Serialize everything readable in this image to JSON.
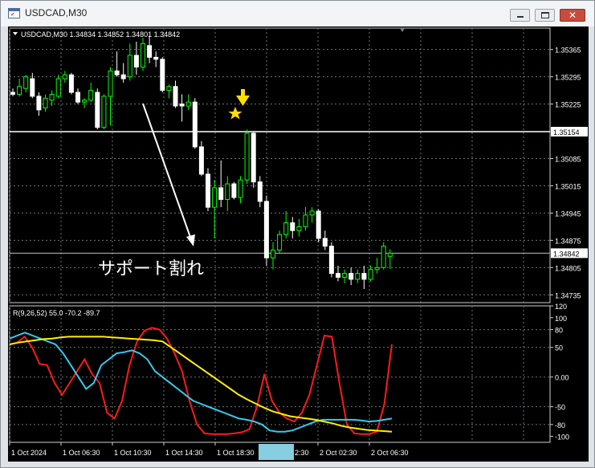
{
  "window": {
    "title": "USDCAD,M30",
    "app_icon_glyph": "✔",
    "close_glyph": "✕"
  },
  "main_panel": {
    "info_label": "USDCAD,M30  1.34834 1.34852 1.34801 1.34842",
    "annotation_text": "サポート割れ",
    "price_ticks": [
      "1.35365",
      "1.35295",
      "1.35225",
      "1.35154",
      "1.35085",
      "1.35015",
      "1.34945",
      "1.34875",
      "1.34842",
      "1.34805",
      "1.34735"
    ],
    "highlighted_levels": [
      {
        "label": "1.35154",
        "value": 1.35154,
        "line_color": "#ffffff",
        "tag_bg": "#ffffff",
        "tag_fg": "#000000"
      },
      {
        "label": "1.34842",
        "value": 1.34842,
        "line_color": "#c0c0c0",
        "tag_bg": "#ffffff",
        "tag_fg": "#000000"
      }
    ],
    "price_range": [
      1.34715,
      1.3542
    ],
    "candle_up_color": "#00ff00",
    "candle_down_color": "#ffffff",
    "background": "#000000",
    "grid_color": "#6a7a6a",
    "arrow_marker_color": "#ffdd00",
    "star_marker_color": "#ffdd00"
  },
  "indicator_panel": {
    "label": "R(9,26,52) 55.0 -70.2 -89.7",
    "ticks": [
      "120",
      "100",
      "80",
      "50",
      "0.00",
      "-50",
      "-80",
      "-100"
    ],
    "range": [
      -110,
      120
    ],
    "level_lines": [
      80,
      50,
      0,
      -50,
      -80
    ],
    "colors": {
      "fast": "#ff1a1a",
      "mid": "#33ccee",
      "slow": "#ffee00"
    }
  },
  "time_axis": {
    "labels": [
      "1 Oct 2024",
      "1 Oct 06:30",
      "1 Oct 10:30",
      "1 Oct 14:30",
      "1 Oct 18:30",
      "2 Oct 02:30",
      "2 Oct 06:30"
    ],
    "partial_label": "2:30",
    "highlight_color": "#87cee0"
  },
  "chart_data": {
    "type": "candlestick",
    "symbol": "USDCAD",
    "timeframe": "M30",
    "ylim": [
      1.34715,
      1.3542
    ],
    "ohlc": [
      [
        1.35255,
        1.35265,
        1.35245,
        1.3525
      ],
      [
        1.3525,
        1.3529,
        1.35245,
        1.3527
      ],
      [
        1.35265,
        1.353,
        1.35255,
        1.35295
      ],
      [
        1.3529,
        1.35305,
        1.3524,
        1.35245
      ],
      [
        1.35245,
        1.35255,
        1.35195,
        1.3521
      ],
      [
        1.35215,
        1.3525,
        1.35205,
        1.3524
      ],
      [
        1.35235,
        1.3526,
        1.3522,
        1.3525
      ],
      [
        1.35245,
        1.353,
        1.3524,
        1.3529
      ],
      [
        1.3529,
        1.3531,
        1.3528,
        1.353
      ],
      [
        1.353,
        1.35305,
        1.3525,
        1.35255
      ],
      [
        1.35255,
        1.35265,
        1.35225,
        1.3523
      ],
      [
        1.3523,
        1.3524,
        1.35215,
        1.35235
      ],
      [
        1.35235,
        1.3528,
        1.3523,
        1.3526
      ],
      [
        1.35255,
        1.35265,
        1.3516,
        1.35165
      ],
      [
        1.35165,
        1.3525,
        1.3516,
        1.35245
      ],
      [
        1.35245,
        1.3532,
        1.3517,
        1.3531
      ],
      [
        1.3531,
        1.3536,
        1.35295,
        1.353
      ],
      [
        1.353,
        1.3533,
        1.3528,
        1.3529
      ],
      [
        1.35295,
        1.3538,
        1.35285,
        1.3535
      ],
      [
        1.3535,
        1.35385,
        1.353,
        1.3532
      ],
      [
        1.3532,
        1.35395,
        1.3531,
        1.3538
      ],
      [
        1.35375,
        1.354,
        1.3533,
        1.35345
      ],
      [
        1.35345,
        1.3536,
        1.3532,
        1.3534
      ],
      [
        1.3534,
        1.35345,
        1.35255,
        1.3526
      ],
      [
        1.3526,
        1.35275,
        1.3524,
        1.3527
      ],
      [
        1.3527,
        1.35285,
        1.35215,
        1.3522
      ],
      [
        1.35225,
        1.3525,
        1.3518,
        1.3522
      ],
      [
        1.3522,
        1.3525,
        1.3521,
        1.3523
      ],
      [
        1.3523,
        1.3524,
        1.3511,
        1.35115
      ],
      [
        1.35115,
        1.3513,
        1.3504,
        1.35045
      ],
      [
        1.35045,
        1.3506,
        1.3495,
        1.3496
      ],
      [
        1.3496,
        1.3503,
        1.3488,
        1.3501
      ],
      [
        1.3501,
        1.3508,
        1.3496,
        1.3498
      ],
      [
        1.3498,
        1.3504,
        1.3495,
        1.3502
      ],
      [
        1.3502,
        1.35025,
        1.3498,
        1.34985
      ],
      [
        1.34985,
        1.3504,
        1.3497,
        1.3503
      ],
      [
        1.3503,
        1.3516,
        1.3502,
        1.3515
      ],
      [
        1.3515,
        1.35155,
        1.3501,
        1.35025
      ],
      [
        1.35025,
        1.3504,
        1.3496,
        1.34975
      ],
      [
        1.34975,
        1.3499,
        1.3481,
        1.3483
      ],
      [
        1.3483,
        1.3487,
        1.348,
        1.3485
      ],
      [
        1.3485,
        1.349,
        1.3484,
        1.3489
      ],
      [
        1.3489,
        1.3495,
        1.3488,
        1.3492
      ],
      [
        1.3492,
        1.34935,
        1.3488,
        1.349
      ],
      [
        1.349,
        1.3493,
        1.34885,
        1.3491
      ],
      [
        1.3491,
        1.3496,
        1.349,
        1.3494
      ],
      [
        1.3494,
        1.3496,
        1.3492,
        1.3495
      ],
      [
        1.3495,
        1.34955,
        1.3487,
        1.3488
      ],
      [
        1.3488,
        1.349,
        1.3485,
        1.3486
      ],
      [
        1.3486,
        1.3487,
        1.3478,
        1.3479
      ],
      [
        1.3479,
        1.3481,
        1.3477,
        1.3478
      ],
      [
        1.3478,
        1.348,
        1.34765,
        1.3479
      ],
      [
        1.3479,
        1.34805,
        1.3476,
        1.34775
      ],
      [
        1.34775,
        1.348,
        1.34765,
        1.3479
      ],
      [
        1.3479,
        1.3481,
        1.3475,
        1.34775
      ],
      [
        1.34775,
        1.3481,
        1.3477,
        1.348
      ],
      [
        1.348,
        1.3483,
        1.3479,
        1.34805
      ],
      [
        1.34805,
        1.3487,
        1.348,
        1.3486
      ],
      [
        1.34834,
        1.34852,
        1.34801,
        1.34842
      ]
    ],
    "series": [
      {
        "values": [
          55,
          58,
          68,
          50,
          22,
          20,
          -10,
          -30,
          -10,
          10,
          30,
          5,
          -10,
          -60,
          -70,
          -40,
          20,
          60,
          78,
          83,
          80,
          65,
          40,
          10,
          -40,
          -80,
          -95,
          -96,
          -96,
          -96,
          -95,
          -93,
          -88,
          -50,
          5,
          -40,
          -60,
          -70,
          -75,
          -60,
          -30,
          20,
          70,
          68,
          -10,
          -80,
          -95,
          -96,
          -96,
          -92,
          -45,
          55
        ]
      },
      {
        "values": [
          65,
          70,
          75,
          70,
          65,
          60,
          55,
          40,
          20,
          0,
          -20,
          -10,
          20,
          30,
          40,
          42,
          45,
          40,
          30,
          10,
          0,
          -10,
          -20,
          -30,
          -40,
          -45,
          -50,
          -55,
          -60,
          -65,
          -70,
          -72,
          -75,
          -80,
          -90,
          -92,
          -92,
          -90,
          -85,
          -80,
          -75,
          -72,
          -72,
          -72,
          -72,
          -72,
          -73,
          -75,
          -74,
          -72,
          -70
        ]
      },
      {
        "values": [
          55,
          58,
          60,
          62,
          64,
          65,
          67,
          68,
          68,
          68,
          68,
          68,
          67,
          66,
          65,
          64,
          63,
          62,
          60,
          50,
          40,
          30,
          20,
          10,
          0,
          -10,
          -20,
          -30,
          -38,
          -45,
          -52,
          -58,
          -62,
          -66,
          -68,
          -70,
          -72,
          -75,
          -78,
          -82,
          -85,
          -87,
          -89,
          -90,
          -91,
          -92
        ]
      }
    ]
  }
}
